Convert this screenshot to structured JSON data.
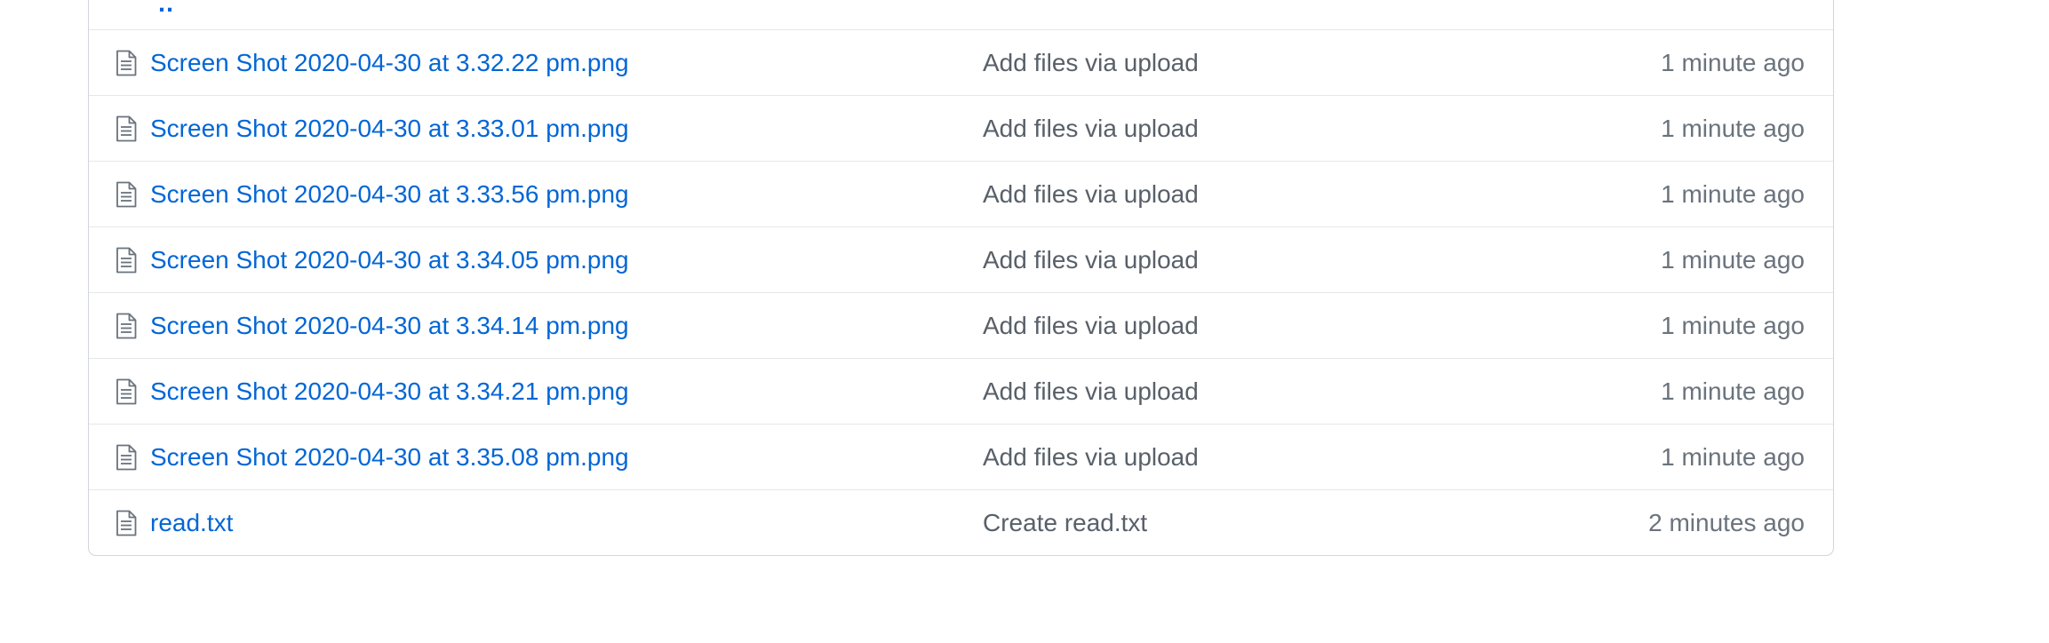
{
  "file_table": {
    "parent_dir_label": "..",
    "rows": [
      {
        "name": "Screen Shot 2020-04-30 at 3.32.22 pm.png",
        "message": "Add files via upload",
        "age": "1 minute ago",
        "icon": "file-icon"
      },
      {
        "name": "Screen Shot 2020-04-30 at 3.33.01 pm.png",
        "message": "Add files via upload",
        "age": "1 minute ago",
        "icon": "file-icon"
      },
      {
        "name": "Screen Shot 2020-04-30 at 3.33.56 pm.png",
        "message": "Add files via upload",
        "age": "1 minute ago",
        "icon": "file-icon"
      },
      {
        "name": "Screen Shot 2020-04-30 at 3.34.05 pm.png",
        "message": "Add files via upload",
        "age": "1 minute ago",
        "icon": "file-icon"
      },
      {
        "name": "Screen Shot 2020-04-30 at 3.34.14 pm.png",
        "message": "Add files via upload",
        "age": "1 minute ago",
        "icon": "file-icon"
      },
      {
        "name": "Screen Shot 2020-04-30 at 3.34.21 pm.png",
        "message": "Add files via upload",
        "age": "1 minute ago",
        "icon": "file-icon"
      },
      {
        "name": "Screen Shot 2020-04-30 at 3.35.08 pm.png",
        "message": "Add files via upload",
        "age": "1 minute ago",
        "icon": "file-icon"
      },
      {
        "name": "read.txt",
        "message": "Create read.txt",
        "age": "2 minutes ago",
        "icon": "file-icon"
      }
    ]
  },
  "colors": {
    "link": "#0366d6",
    "message": "#586069",
    "age": "#6a737d",
    "border": "#d1d5da",
    "row_divider": "#e4e7ea",
    "icon": "#6a737d"
  }
}
